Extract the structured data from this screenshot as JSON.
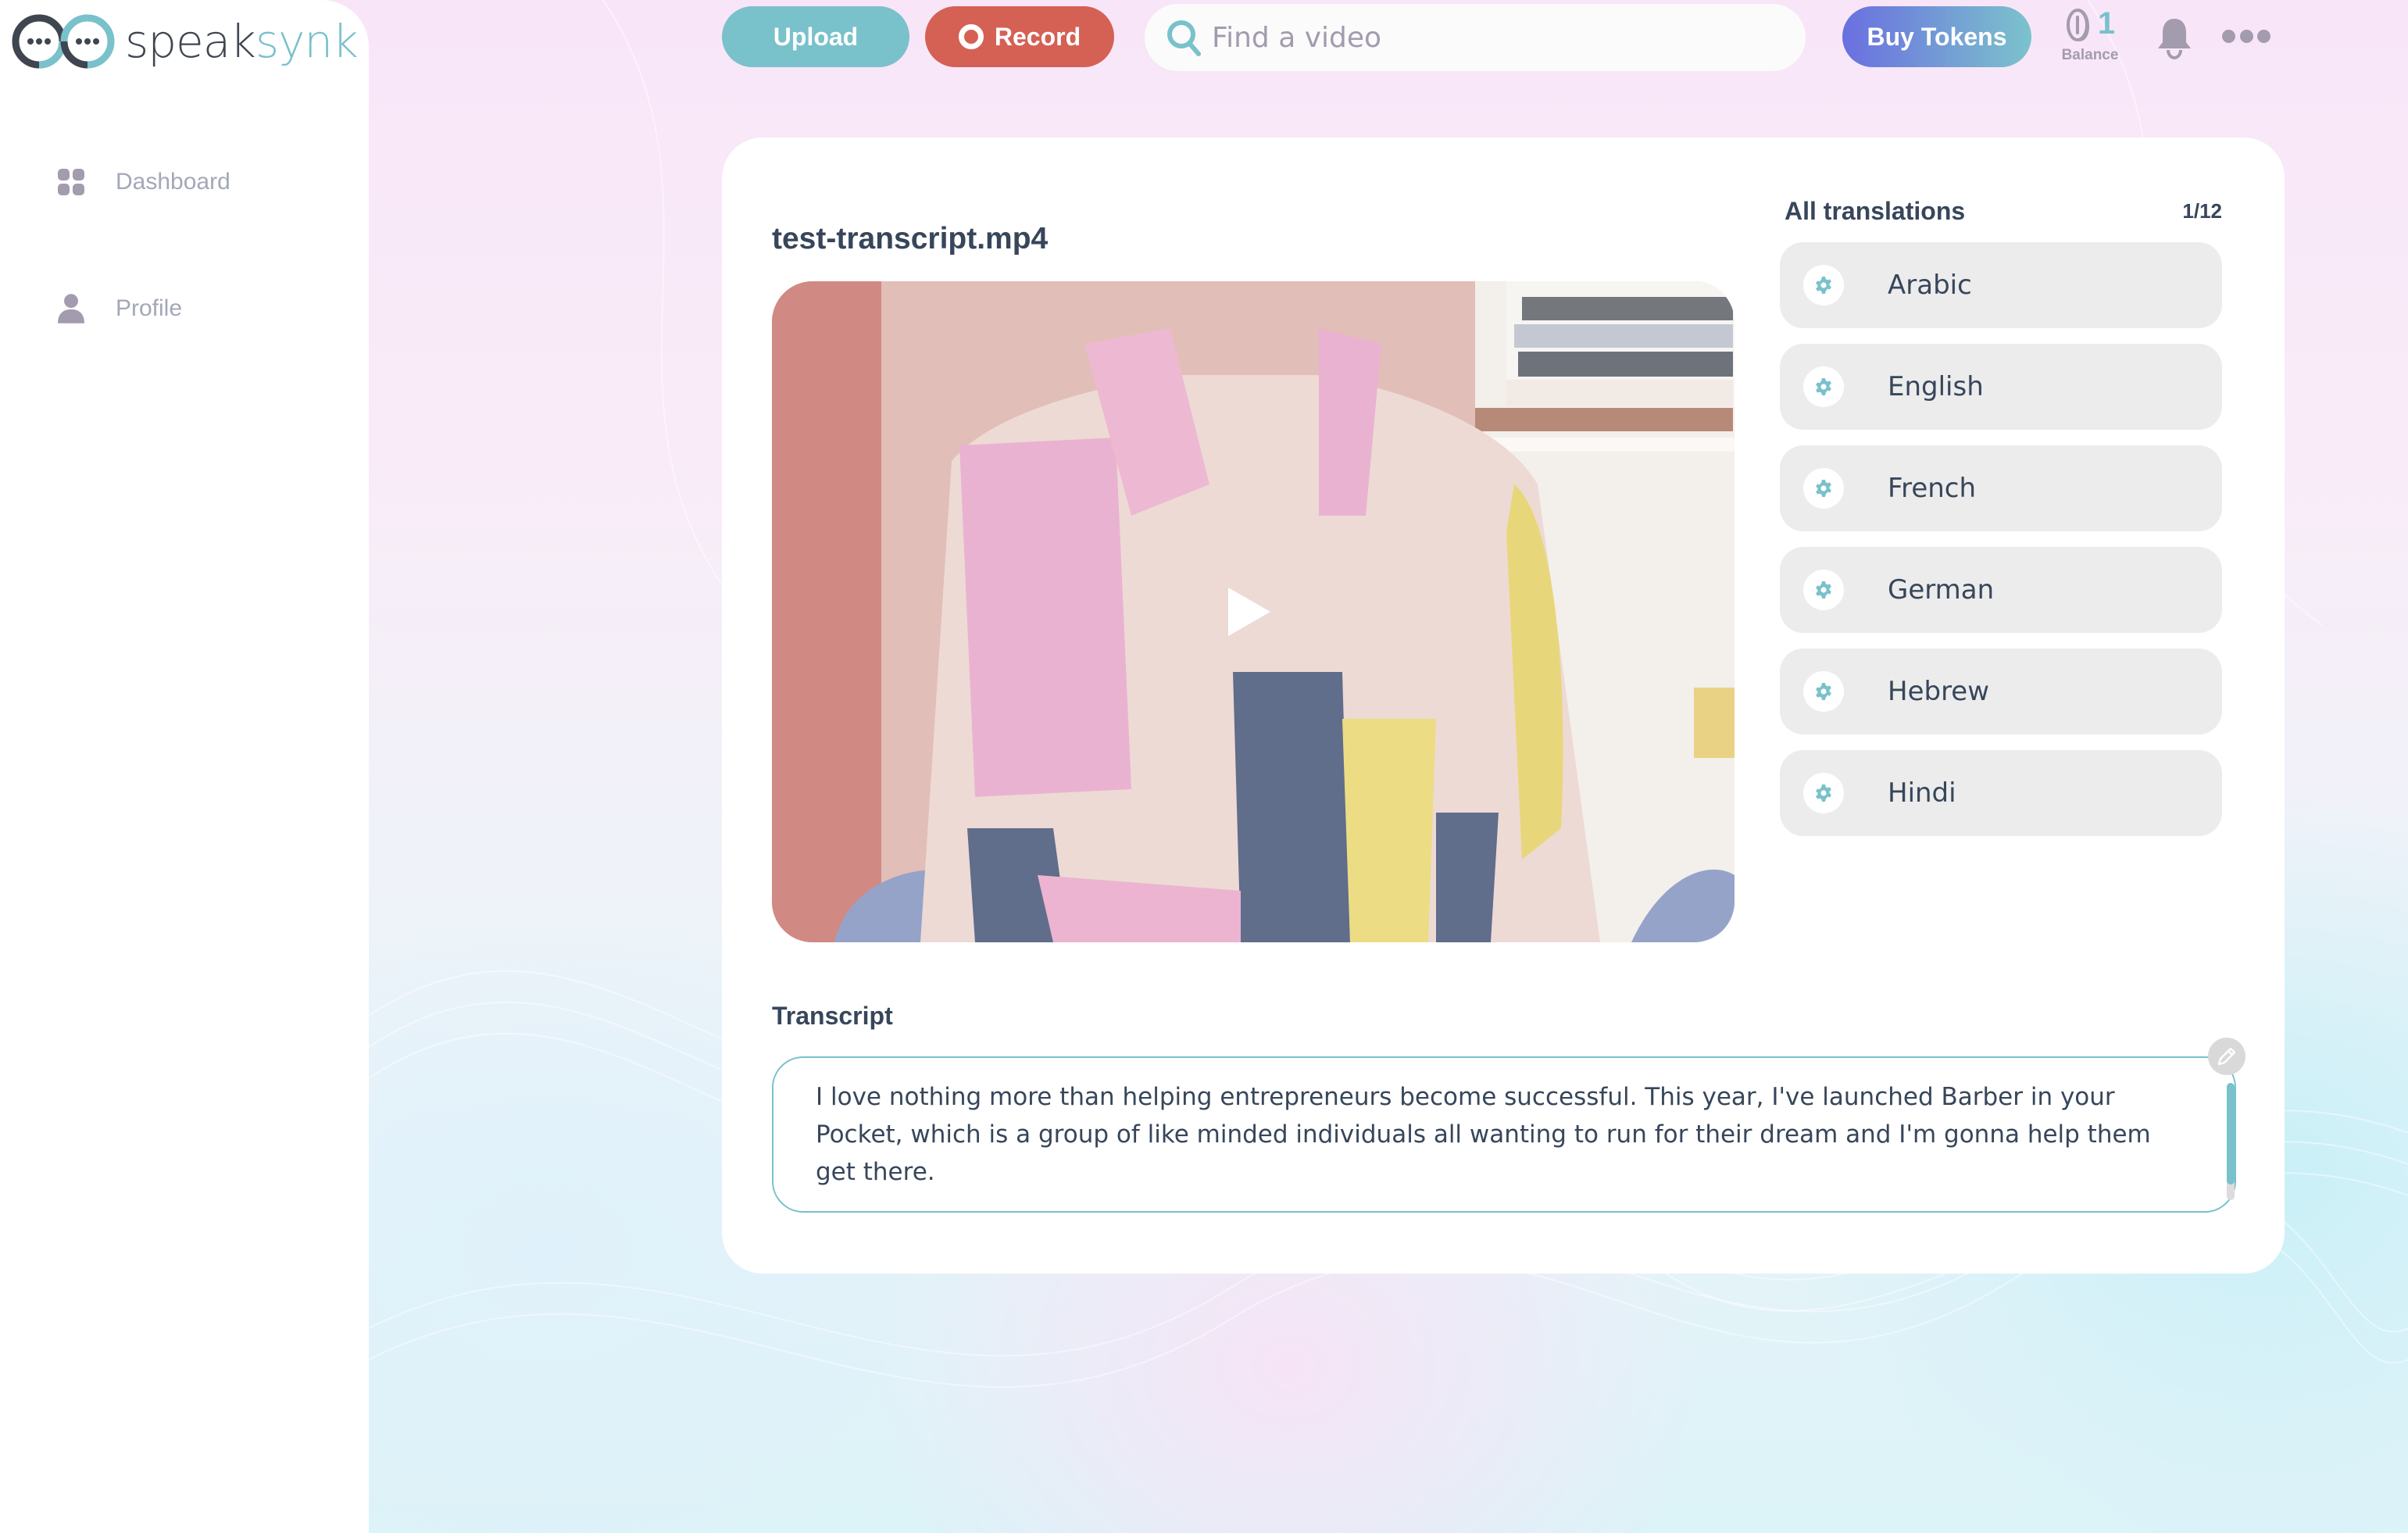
{
  "brand": {
    "name_part1": "speak",
    "name_part2": "synk"
  },
  "sidebar": {
    "items": [
      {
        "label": "Dashboard",
        "icon": "grid-icon"
      },
      {
        "label": "Profile",
        "icon": "user-icon"
      }
    ]
  },
  "topbar": {
    "upload_label": "Upload",
    "record_label": "Record",
    "search_placeholder": "Find a video",
    "search_value": "",
    "buy_tokens_label": "Buy Tokens",
    "balance_value": "1",
    "balance_label": "Balance"
  },
  "video": {
    "title": "test-transcript.mp4"
  },
  "translations": {
    "heading": "All translations",
    "count": "1/12",
    "items": [
      {
        "label": "Arabic"
      },
      {
        "label": "English"
      },
      {
        "label": "French"
      },
      {
        "label": "German"
      },
      {
        "label": "Hebrew"
      },
      {
        "label": "Hindi"
      }
    ]
  },
  "transcript": {
    "label": "Transcript",
    "text": "I love nothing more than helping entrepreneurs become successful. This year, I've launched Barber in your Pocket, which is a group of like minded individuals all wanting to run for their dream and I'm gonna help them get there."
  },
  "colors": {
    "accent": "#79c1cb",
    "record": "#d56054",
    "buy_gradient_start": "#6a6fe0",
    "buy_gradient_end": "#7bc3cc",
    "text_dark": "#37465a",
    "muted": "#a39bae"
  }
}
